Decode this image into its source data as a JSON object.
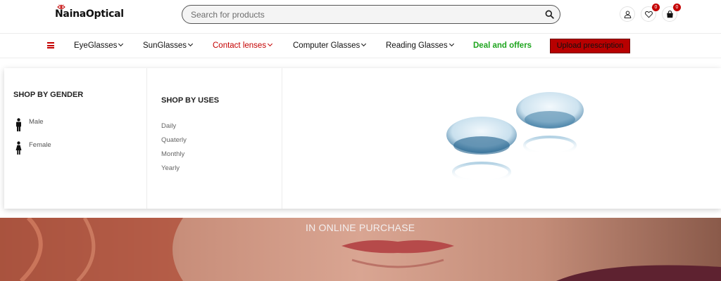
{
  "header": {
    "logo_text": "NainaOptical",
    "search": {
      "placeholder": "Search for products"
    },
    "wishlist_count": "0",
    "cart_count": "0"
  },
  "nav": {
    "items": [
      {
        "label": "EyeGlasses"
      },
      {
        "label": "SunGlasses"
      },
      {
        "label": "Contact lenses"
      },
      {
        "label": "Computer Glasses"
      },
      {
        "label": "Reading Glasses"
      },
      {
        "label": "Deal and offers"
      }
    ],
    "upload_label": "Upload prescription"
  },
  "mega_menu": {
    "gender": {
      "title": "SHOP BY GENDER",
      "items": [
        {
          "label": "Male"
        },
        {
          "label": "Female"
        }
      ]
    },
    "uses": {
      "title": "SHOP BY USES",
      "items": [
        {
          "label": "Daily"
        },
        {
          "label": "Quaterly"
        },
        {
          "label": "Monthly"
        },
        {
          "label": "Yearly"
        }
      ]
    }
  },
  "hero": {
    "text": "IN ONLINE PURCHASE"
  },
  "colors": {
    "accent": "#c40000",
    "offer": "#1ea51e",
    "upload_bg": "#b80000"
  },
  "icons": [
    "eye-logo-icon",
    "search-icon",
    "user-icon",
    "heart-icon",
    "cart-icon",
    "menu-icon",
    "chevron-down-icon",
    "male-icon",
    "female-icon"
  ]
}
